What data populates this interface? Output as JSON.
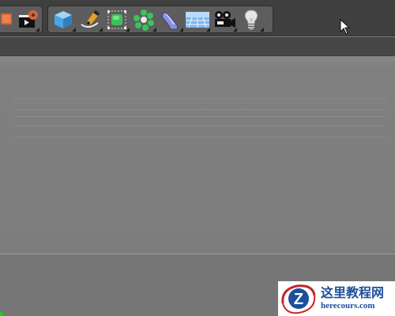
{
  "toolbar": {
    "left_group": {
      "tools": [
        {
          "name": "render-to-picture-viewer",
          "icon": "render-icon",
          "color": "#e8612c"
        },
        {
          "name": "render-settings",
          "icon": "clapper-gear-icon",
          "color": "#e8612c"
        }
      ]
    },
    "main_group": {
      "tools": [
        {
          "name": "cube",
          "icon": "cube-icon",
          "color": "#4aa6e6"
        },
        {
          "name": "pen",
          "icon": "pen-icon",
          "color": "#e8a020"
        },
        {
          "name": "subdivision-surface",
          "icon": "subdivision-cube-icon",
          "color": "#3bc35a"
        },
        {
          "name": "array-cloner",
          "icon": "array-icon",
          "color": "#3bc35a"
        },
        {
          "name": "deformer",
          "icon": "bend-icon",
          "color": "#8a8fe0"
        },
        {
          "name": "floor",
          "icon": "floor-grid-icon",
          "color": "#7fb8ee"
        },
        {
          "name": "camera",
          "icon": "camera-icon",
          "color": "#111111"
        },
        {
          "name": "light",
          "icon": "light-bulb-icon",
          "color": "#dddddd"
        }
      ]
    }
  },
  "watermark": {
    "title": "这里教程网",
    "url": "herecours.com",
    "logo_letter": "Z"
  }
}
